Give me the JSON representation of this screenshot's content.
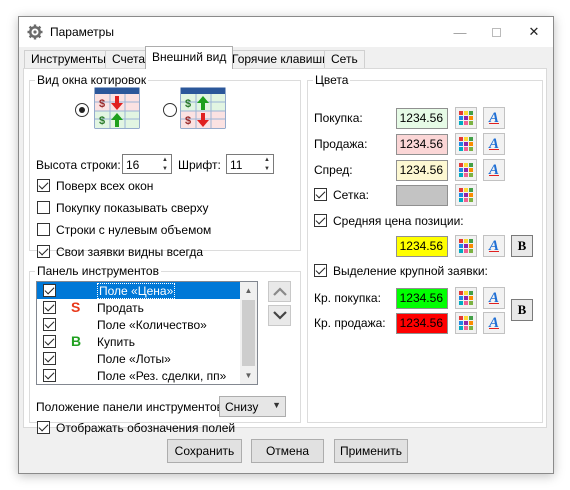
{
  "window": {
    "title": "Параметры"
  },
  "tabs": [
    {
      "label": "Инструменты"
    },
    {
      "label": "Счета"
    },
    {
      "label": "Внешний вид",
      "active": true
    },
    {
      "label": "Горячие клавиши"
    },
    {
      "label": "Сеть"
    }
  ],
  "quote_view": {
    "legend": "Вид окна котировок",
    "selected_option": 1,
    "row_height_label": "Высота строки:",
    "row_height_value": "16",
    "font_label": "Шрифт:",
    "font_value": "11",
    "options": [
      {
        "label": "Поверх всех окон",
        "checked": true
      },
      {
        "label": "Покупку показывать сверху",
        "checked": false
      },
      {
        "label": "Строки с нулевым объемом",
        "checked": false
      },
      {
        "label": "Свои заявки видны всегда",
        "checked": true
      }
    ]
  },
  "toolbar_panel": {
    "legend": "Панель инструментов",
    "items": [
      {
        "icon": "",
        "label": "Поле «Цена»",
        "checked": true,
        "selected": true
      },
      {
        "icon": "S",
        "icon_color": "#e8381a",
        "label": "Продать",
        "checked": true
      },
      {
        "icon": "",
        "label": "Поле «Количество»",
        "checked": true
      },
      {
        "icon": "B",
        "icon_color": "#21a121",
        "label": "Купить",
        "checked": true
      },
      {
        "icon": "",
        "label": "Поле «Лоты»",
        "checked": true
      },
      {
        "icon": "",
        "label": "Поле «Рез. сделки, пп»",
        "checked": true
      }
    ],
    "position_label": "Положение панели инструментов:",
    "position_value": "Снизу",
    "show_labels": {
      "label": "Отображать обозначения полей",
      "checked": true
    }
  },
  "colors": {
    "legend": "Цвета",
    "buy": {
      "label": "Покупка:",
      "value": "1234.56",
      "bg": "#e6fbe6"
    },
    "sell": {
      "label": "Продажа:",
      "value": "1234.56",
      "bg": "#fbd6d6"
    },
    "spread": {
      "label": "Спред:",
      "value": "1234.56",
      "bg": "#fdf8d2"
    },
    "grid": {
      "label": "Сетка:",
      "checked": true,
      "swatch": "#c3c3c3"
    },
    "avg_price": {
      "label": "Средняя цена позиции:",
      "checked": true,
      "value": "1234.56",
      "bg": "#ffff00"
    },
    "large_order": {
      "label": "Выделение крупной заявки:",
      "checked": true
    },
    "large_buy": {
      "label": "Кр. покупка:",
      "value": "1234.56",
      "bg": "#00ff00"
    },
    "large_sell": {
      "label": "Кр. продажа:",
      "value": "1234.56",
      "bg": "#ff0000"
    },
    "bold_glyph": "B"
  },
  "buttons": {
    "save": "Сохранить",
    "cancel": "Отмена",
    "apply": "Применить"
  },
  "icons": {
    "gear": "gear-icon",
    "minimize": "minimize-icon",
    "maximize": "maximize-icon",
    "close": "close-icon",
    "palette": "palette-icon",
    "font": "font-icon",
    "bold": "bold-icon",
    "up": "arrow-up-icon",
    "down": "arrow-down-icon"
  }
}
